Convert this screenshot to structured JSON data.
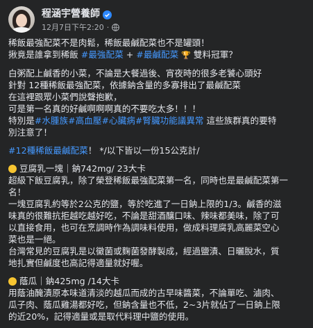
{
  "author": {
    "name": "程涵宇營養師",
    "timestamp": "12月7日下午2:20",
    "separator": "·"
  },
  "icons": {
    "avatar": "profile-photo",
    "verified": "verified-badge-icon",
    "privacy": "globe-icon",
    "section_bullet": "yellow-circle-icon",
    "trophy": "trophy-icon"
  },
  "colors": {
    "background": "#242526",
    "text": "#e4e6eb",
    "link": "#4599ff",
    "verified": "#2d88ff",
    "bullet": "#f7c531"
  },
  "post": {
    "intro": {
      "l1": "稀飯最強配菜不是肉鬆，稀飯最鹹配菜也不是罐頭！",
      "l2_a": "揪竟是誰拿到稀飯 ",
      "l2_tag1": "#最強配菜",
      "l2_mid": " + ",
      "l2_tag2": "#最鹹配菜",
      "l2_trophy": "🏆",
      "l2_b": " 雙料冠軍？"
    },
    "para2": {
      "l1": "白粥配上鹹香的小菜，不論是大餐過後、宵夜時的很多老饕心頭好",
      "l2": "針對 12種稀飯最強配菜，依據鈉含量的多寡排出了最鹹配菜",
      "l3": "在這裡跟眾小菜們說聲抱歉，",
      "l4": "可是第一名真的好鹹啊啊啊真的不要吃太多！！！",
      "l5_a": "特別是",
      "l5_t1": "#水腫族",
      "l5_t2": "#高血壓",
      "l5_t3": "#心臟病",
      "l5_t4": "#腎臟功能議異常",
      "l5_b": " 這些族群真的要特",
      "l6": "別注意了！"
    },
    "para3": {
      "tag": "#12種稀飯最鹹配菜",
      "text": "！ */以下皆以一份15公克計/"
    },
    "sec1": {
      "title": "豆腐乳一塊｜鈉742mg/ 23大卡",
      "l1": "超級下飯豆腐乳，除了榮登稀飯最強配菜第一名，同時也是最鹹配菜第一",
      "l2": "名！",
      "l3": "一塊豆腐乳約等於2公克的鹽，等於吃進了一日鈉上限的1/3。鹹香的滋",
      "l4": "味真的很難抗拒越吃越好吃，不論是甜酒釀口味、辣味都美味，除了可",
      "l5": "以直接食用，也可在烹調時作為調味料使用，做成料理腐乳高麗菜空心",
      "l6": "菜也是一絕。",
      "l7": "台灣常見的豆腐乳是以黴菌或麴菌發酵製成，經過鹽漬、日曬脫水，質",
      "l8": "地扎實但鹹度也高記得適量就好喔。"
    },
    "sec2": {
      "title": "蔭瓜｜鈉425mg /14大卡",
      "l1": "用蔭油醃漬原本味道清淡的越瓜而成的古早味醬菜，不論單吃、滷肉、",
      "l2": "瓜子肉、蔭瓜雞湯都好吃，但鈉含量也不低，2~3片就佔了一日鈉上限",
      "l3": "的近20%，記得適量或是取代料理中鹽的使用。"
    }
  }
}
